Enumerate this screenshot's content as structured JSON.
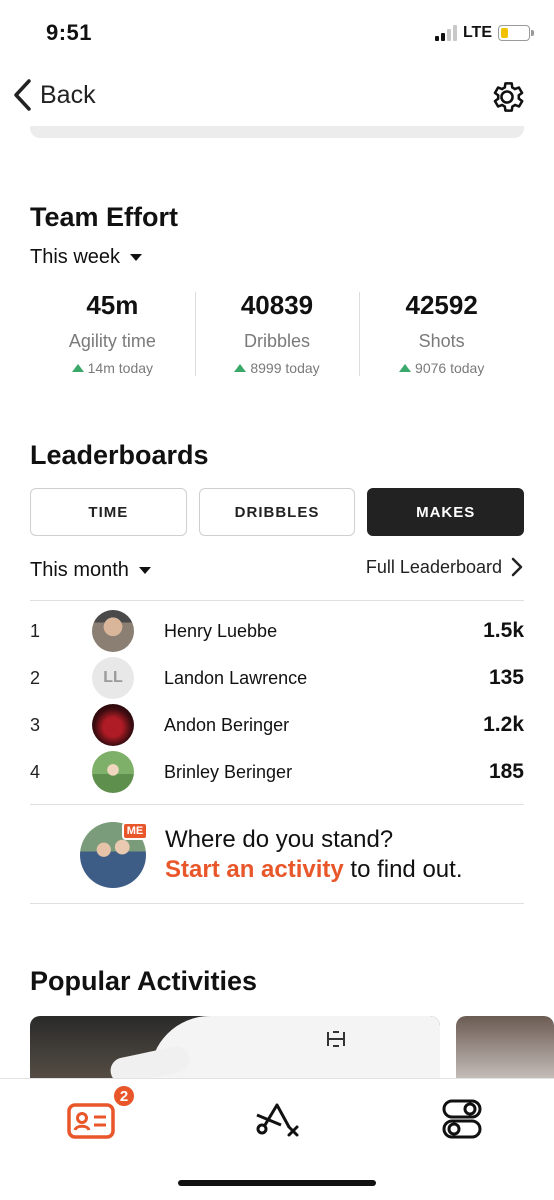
{
  "status_bar": {
    "time": "9:51",
    "network": "LTE",
    "battery_level": 0.25,
    "battery_color": "#f2c200"
  },
  "nav": {
    "back_label": "Back"
  },
  "team_effort": {
    "title": "Team Effort",
    "period": "This week",
    "stats": [
      {
        "value": "45m",
        "label": "Agility time",
        "today": "14m today"
      },
      {
        "value": "40839",
        "label": "Dribbles",
        "today": "8999 today"
      },
      {
        "value": "42592",
        "label": "Shots",
        "today": "9076 today"
      }
    ],
    "trend_color": "#3aa86a"
  },
  "leaderboards": {
    "title": "Leaderboards",
    "tabs": [
      {
        "label": "TIME",
        "active": false
      },
      {
        "label": "DRIBBLES",
        "active": false
      },
      {
        "label": "MAKES",
        "active": true
      }
    ],
    "period": "This month",
    "full_link": "Full Leaderboard",
    "rows": [
      {
        "rank": "1",
        "name": "Henry  Luebbe",
        "score": "1.5k",
        "avatar": "photo"
      },
      {
        "rank": "2",
        "name": "Landon Lawrence",
        "score": "135",
        "avatar": "LL"
      },
      {
        "rank": "3",
        "name": "Andon Beringer",
        "score": "1.2k",
        "avatar": "photo"
      },
      {
        "rank": "4",
        "name": "Brinley Beringer",
        "score": "185",
        "avatar": "photo"
      }
    ]
  },
  "stand": {
    "badge": "ME",
    "question": "Where do you stand?",
    "cta_link": "Start an activity",
    "cta_rest": " to find out.",
    "accent": "#e8562a"
  },
  "popular": {
    "title": "Popular Activities"
  },
  "tab_bar": {
    "items": [
      "profile-card-icon",
      "play-diagram-icon",
      "toggles-icon"
    ],
    "badge_count": "2"
  }
}
